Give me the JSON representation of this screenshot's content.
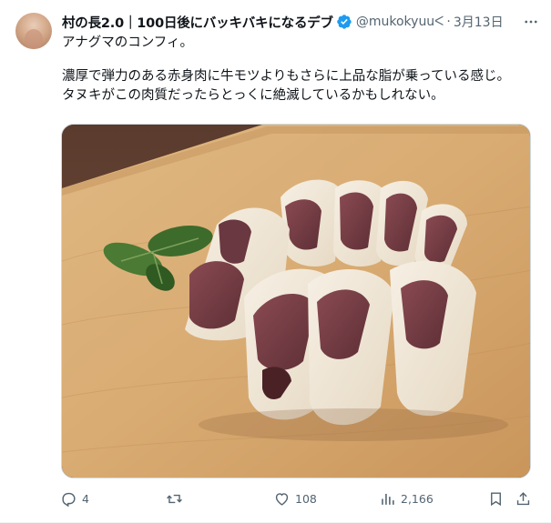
{
  "tweet": {
    "display_name": "村の長2.0｜100日後にバッキバキになるデブ",
    "handle": "@mukokyuuᐸ",
    "separator": "·",
    "date": "3月13日",
    "text_line1": "アナグマのコンフィ。",
    "text_line2": "濃厚で弾力のある赤身肉に牛モツよりもさらに上品な脂が乗っている感じ。",
    "text_line3": "タヌキがこの肉質だったらとっくに絶滅しているかもしれない。",
    "verified_color": "#1d9bf0",
    "icons": {
      "avatar": "avatar",
      "verified": "verified-badge-icon",
      "more": "more-icon"
    }
  },
  "actions": {
    "reply_count": "4",
    "retweet_count": "",
    "like_count": "108",
    "views_count": "2,166",
    "icons": [
      "reply-icon",
      "retweet-icon",
      "like-icon",
      "views-icon",
      "bookmark-icon",
      "share-icon"
    ]
  },
  "media": {
    "icon": "food-photo"
  },
  "colors": {
    "text_primary": "#0f1419",
    "text_secondary": "#536471",
    "border": "#cfd9de",
    "accent": "#1d9bf0"
  }
}
